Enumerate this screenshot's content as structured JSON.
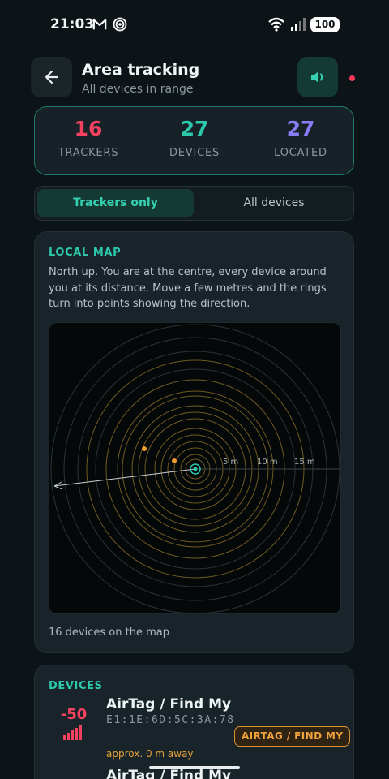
{
  "status_bar": {
    "time": "21:03",
    "battery": "100",
    "icons": [
      "gmail-icon",
      "radio-icon",
      "wifi-icon",
      "signal-icon",
      "battery-icon"
    ]
  },
  "header": {
    "title": "Area tracking",
    "subtitle": "All devices in range",
    "back_icon": "arrow-left-icon",
    "sound_icon": "speaker-icon",
    "recording_dot_color": "#ff3b5c"
  },
  "stats": [
    {
      "value": "16",
      "label": "TRACKERS",
      "color": "#f2425f"
    },
    {
      "value": "27",
      "label": "DEVICES",
      "color": "#2cc9ad"
    },
    {
      "value": "27",
      "label": "LOCATED",
      "color": "#8a7cf6"
    }
  ],
  "tabs": [
    {
      "label": "Trackers only",
      "active": true
    },
    {
      "label": "All devices",
      "active": false
    }
  ],
  "map_card": {
    "label": "LOCAL MAP",
    "description": "North up. You are at the centre, every device around you at its distance. Move a few metres and the rings turn into points showing the direction.",
    "ring_labels": [
      "5 m",
      "10 m",
      "15 m"
    ],
    "footer": "16 devices on the map"
  },
  "devices_card": {
    "label": "DEVICES",
    "rows": [
      {
        "rssi": "-50",
        "name": "AirTag / Find My",
        "mac": "E1:1E:6D:5C:3A:78",
        "badge": "AIRTAG / FIND MY",
        "distance": "approx. 0 m away"
      },
      {
        "name": "AirTag / Find My"
      }
    ]
  },
  "colors": {
    "accent": "#2cc9ad",
    "tracker": "#f2425f",
    "located": "#8a7cf6",
    "warning": "#e0912f",
    "background": "#0d1418",
    "card": "#18242a"
  }
}
